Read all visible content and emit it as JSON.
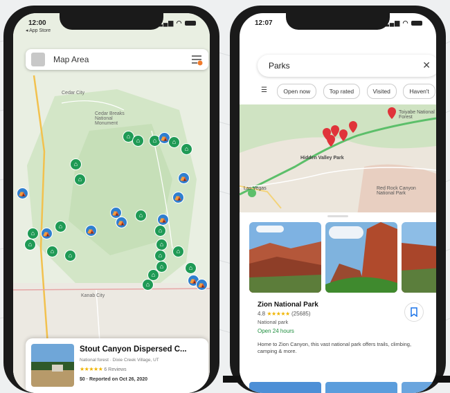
{
  "left_phone": {
    "status": {
      "time": "12:00",
      "back_app": "◂ App Store"
    },
    "search": {
      "label": "Map Area"
    },
    "map_labels": [
      "Cedar City",
      "Cedar Breaks National Monument",
      "Kanab City"
    ],
    "card": {
      "title": "Stout Canyon Dispersed C...",
      "subtitle": "National forest · Dixie Creek Village, UT",
      "stars": "★★★★★",
      "rating": "6 Reviews",
      "footer": "$0 · Reported on Oct 26, 2020"
    }
  },
  "right_phone": {
    "status": {
      "time": "12:07"
    },
    "search": {
      "query": "Parks",
      "clear": "✕"
    },
    "chips": [
      {
        "label": "Open now"
      },
      {
        "label": "Top rated"
      },
      {
        "label": "Visited"
      },
      {
        "label": "Haven't"
      }
    ],
    "map_labels": [
      "Hidden Valley Park",
      "Las Vegas",
      "Red Rock Canyon National Park",
      "Toiyabe National Forest"
    ],
    "place": {
      "name": "Zion National Park",
      "rating": "4.8",
      "stars": "★★★★★",
      "reviews": "(25685)",
      "type": "National park",
      "hours": "Open 24 hours",
      "description": "Home to Zion Canyon, this vast national park offers trails, climbing, camping & more."
    }
  },
  "colors": {
    "green_pin": "#1f9a55",
    "blue_pin": "#2f7fcf",
    "red_pin": "#e0343a",
    "open_green": "#1e8e3e",
    "star": "#f0b400"
  }
}
